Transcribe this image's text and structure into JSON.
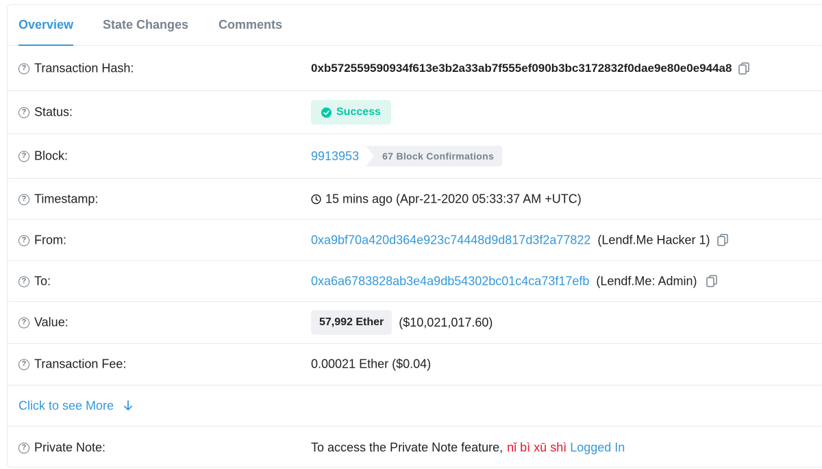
{
  "tabs": [
    {
      "label": "Overview",
      "active": true
    },
    {
      "label": "State Changes",
      "active": false
    },
    {
      "label": "Comments",
      "active": false
    }
  ],
  "rows": {
    "hash": {
      "label": "Transaction Hash:",
      "value": "0xb572559590934f613e3b2a33ab7f555ef090b3bc3172832f0dae9e80e0e944a8"
    },
    "status": {
      "label": "Status:",
      "value": "Success"
    },
    "block": {
      "label": "Block:",
      "number": "9913953",
      "confirmations": "67 Block Confirmations"
    },
    "timestamp": {
      "label": "Timestamp:",
      "value": "15 mins ago (Apr-21-2020 05:33:37 AM +UTC)"
    },
    "from": {
      "label": "From:",
      "address": "0xa9bf70a420d364e923c74448d9d817d3f2a77822",
      "tag": "(Lendf.Me Hacker 1)"
    },
    "to": {
      "label": "To:",
      "address": "0xa6a6783828ab3e4a9db54302bc01c4ca73f17efb",
      "tag": "(Lendf.Me: Admin)"
    },
    "value": {
      "label": "Value:",
      "amount": "57,992 Ether",
      "usd": "($10,021,017.60)"
    },
    "fee": {
      "label": "Transaction Fee:",
      "value": "0.00021 Ether ($0.04)"
    },
    "more": {
      "label": "Click to see More"
    },
    "note": {
      "label": "Private Note:",
      "prefix": "To access the Private Note feature,",
      "red_text": "nǐ bì xū shì",
      "link": "Logged In"
    }
  },
  "colors": {
    "accent": "#3498db",
    "success": "#00c9a7",
    "success_bg": "#dff7f0",
    "badge_bg": "#eef0f3",
    "red": "#e8162c",
    "border": "#e7eaf3"
  },
  "icons": {
    "help": "question-circle-icon",
    "copy": "copy-icon",
    "success": "check-circle-icon",
    "clock": "clock-icon",
    "more": "arrow-down-icon"
  }
}
